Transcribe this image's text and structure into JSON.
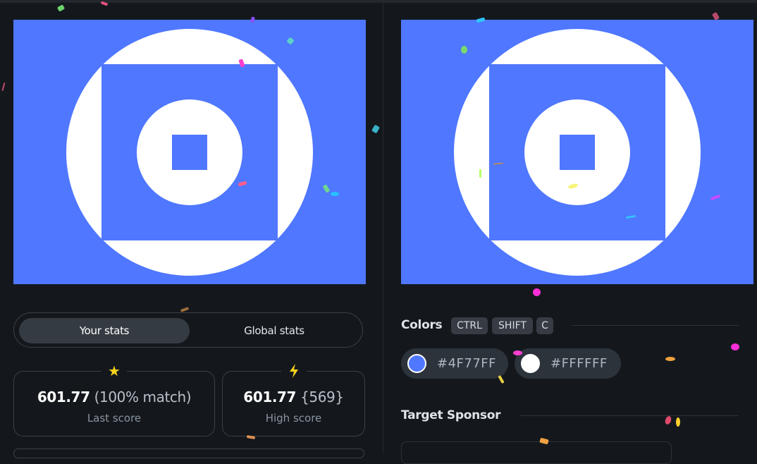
{
  "canvases": {
    "output": {
      "background": "#4F77FF",
      "foreground": "#FFFFFF"
    },
    "target": {
      "background": "#4F77FF",
      "foreground": "#FFFFFF"
    }
  },
  "stats_toggle": {
    "your_stats": "Your stats",
    "global_stats": "Global stats",
    "active": "Your stats"
  },
  "last_score": {
    "icon": "star-icon",
    "value": "601.77",
    "detail": "(100% match)",
    "label": "Last score"
  },
  "high_score": {
    "icon": "lightning-icon",
    "value": "601.77",
    "detail": "{569}",
    "label": "High score"
  },
  "colors": {
    "title": "Colors",
    "shortcut": [
      "CTRL",
      "SHIFT",
      "C"
    ],
    "items": [
      {
        "hex": "#4F77FF",
        "swatch": "#4F77FF"
      },
      {
        "hex": "#FFFFFF",
        "swatch": "#FFFFFF"
      }
    ]
  },
  "sponsor": {
    "title": "Target Sponsor"
  }
}
